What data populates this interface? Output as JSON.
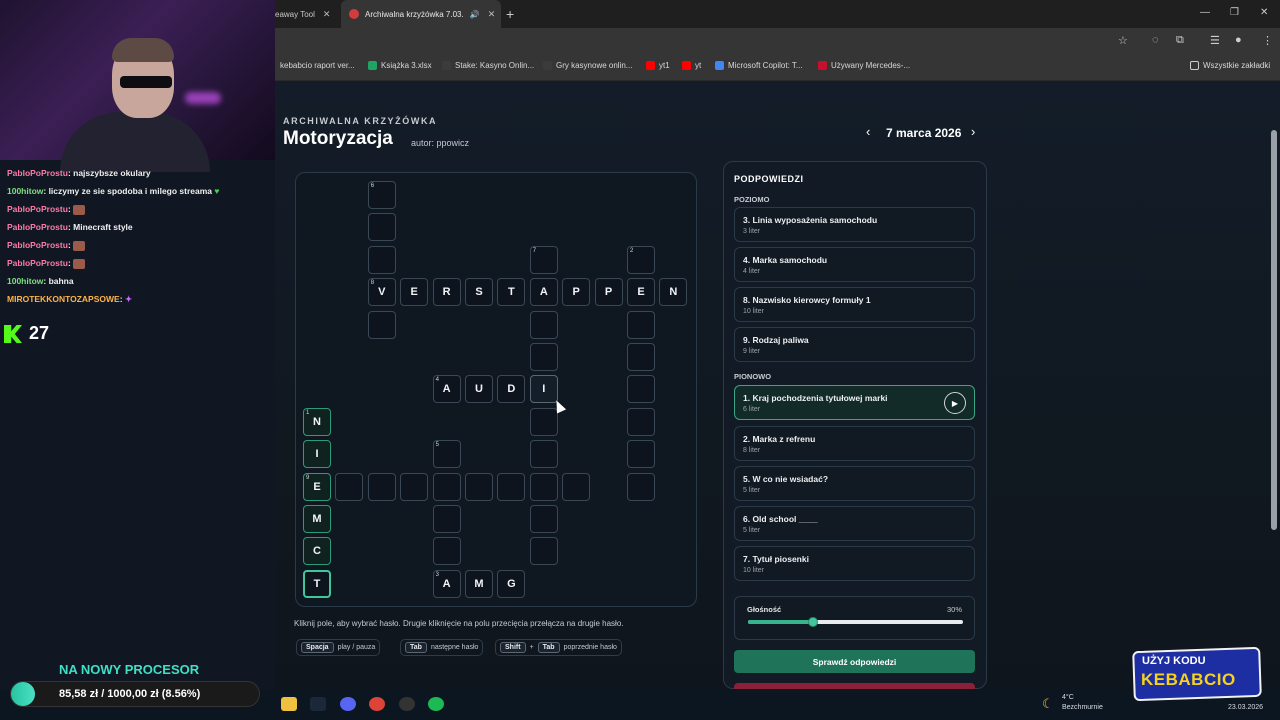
{
  "browser": {
    "tabs": [
      {
        "label": "eaway Tool"
      },
      {
        "label": "Archiwalna krzyżówka 7.03."
      }
    ],
    "bookmarks": [
      "kebabcio raport ver...",
      "Książka 3.xlsx",
      "Stake: Kasyno Onlin...",
      "Gry kasynowe onlin...",
      "yt1",
      "yt",
      "Microsoft Copilot: T...",
      "Używany Mercedes-...",
      "Wszystkie zakładki"
    ],
    "accent": "#41c69c"
  },
  "crossword": {
    "eyebrow": "ARCHIWALNA KRZYŻÓWKA",
    "title": "Motoryzacja",
    "author": "autor: ppowicz",
    "date": "7 marca 2026",
    "prev_icon": "chevron-left-icon",
    "next_icon": "chevron-right-icon",
    "hint": "Kliknij pole, aby wybrać hasło. Drugie kliknięcie na polu przecięcia przełącza na drugie hasło.",
    "shortcuts": [
      {
        "keys": [
          "Spacja"
        ],
        "label": "play / pauza"
      },
      {
        "keys": [
          "Tab"
        ],
        "label": "następne hasło"
      },
      {
        "keys": [
          "Shift",
          "Tab"
        ],
        "label": "poprzednie hasło"
      }
    ],
    "shortcut_plus": "+",
    "cells": [
      {
        "r": 0,
        "c": 2,
        "n": "6",
        "l": ""
      },
      {
        "r": 1,
        "c": 2,
        "n": "",
        "l": ""
      },
      {
        "r": 2,
        "c": 2,
        "n": "",
        "l": ""
      },
      {
        "r": 2,
        "c": 7,
        "n": "7",
        "l": ""
      },
      {
        "r": 2,
        "c": 10,
        "n": "2",
        "l": ""
      },
      {
        "r": 3,
        "c": 2,
        "n": "8",
        "l": "V"
      },
      {
        "r": 3,
        "c": 3,
        "n": "",
        "l": "E"
      },
      {
        "r": 3,
        "c": 4,
        "n": "",
        "l": "R"
      },
      {
        "r": 3,
        "c": 5,
        "n": "",
        "l": "S"
      },
      {
        "r": 3,
        "c": 6,
        "n": "",
        "l": "T"
      },
      {
        "r": 3,
        "c": 7,
        "n": "",
        "l": "A"
      },
      {
        "r": 3,
        "c": 8,
        "n": "",
        "l": "P"
      },
      {
        "r": 3,
        "c": 9,
        "n": "",
        "l": "P"
      },
      {
        "r": 3,
        "c": 10,
        "n": "",
        "l": "E"
      },
      {
        "r": 3,
        "c": 11,
        "n": "",
        "l": "N"
      },
      {
        "r": 4,
        "c": 2,
        "n": "",
        "l": ""
      },
      {
        "r": 4,
        "c": 7,
        "n": "",
        "l": ""
      },
      {
        "r": 4,
        "c": 10,
        "n": "",
        "l": ""
      },
      {
        "r": 5,
        "c": 7,
        "n": "",
        "l": ""
      },
      {
        "r": 5,
        "c": 10,
        "n": "",
        "l": ""
      },
      {
        "r": 6,
        "c": 4,
        "n": "4",
        "l": "A"
      },
      {
        "r": 6,
        "c": 5,
        "n": "",
        "l": "U"
      },
      {
        "r": 6,
        "c": 6,
        "n": "",
        "l": "D"
      },
      {
        "r": 6,
        "c": 7,
        "n": "",
        "l": "I",
        "s": "hl"
      },
      {
        "r": 6,
        "c": 10,
        "n": "",
        "l": ""
      },
      {
        "r": 7,
        "c": 0,
        "n": "1",
        "l": "N",
        "s": "sel"
      },
      {
        "r": 7,
        "c": 7,
        "n": "",
        "l": ""
      },
      {
        "r": 7,
        "c": 10,
        "n": "",
        "l": ""
      },
      {
        "r": 8,
        "c": 0,
        "n": "",
        "l": "I",
        "s": "sel"
      },
      {
        "r": 8,
        "c": 4,
        "n": "5",
        "l": ""
      },
      {
        "r": 8,
        "c": 7,
        "n": "",
        "l": ""
      },
      {
        "r": 8,
        "c": 10,
        "n": "",
        "l": ""
      },
      {
        "r": 9,
        "c": 0,
        "n": "9",
        "l": "E",
        "s": "sel"
      },
      {
        "r": 9,
        "c": 1,
        "n": "",
        "l": ""
      },
      {
        "r": 9,
        "c": 2,
        "n": "",
        "l": ""
      },
      {
        "r": 9,
        "c": 3,
        "n": "",
        "l": ""
      },
      {
        "r": 9,
        "c": 4,
        "n": "",
        "l": ""
      },
      {
        "r": 9,
        "c": 5,
        "n": "",
        "l": ""
      },
      {
        "r": 9,
        "c": 6,
        "n": "",
        "l": ""
      },
      {
        "r": 9,
        "c": 7,
        "n": "",
        "l": ""
      },
      {
        "r": 9,
        "c": 8,
        "n": "",
        "l": ""
      },
      {
        "r": 9,
        "c": 10,
        "n": "",
        "l": ""
      },
      {
        "r": 10,
        "c": 0,
        "n": "",
        "l": "M",
        "s": "sel"
      },
      {
        "r": 10,
        "c": 4,
        "n": "",
        "l": ""
      },
      {
        "r": 10,
        "c": 7,
        "n": "",
        "l": ""
      },
      {
        "r": 11,
        "c": 0,
        "n": "",
        "l": "C",
        "s": "sel"
      },
      {
        "r": 11,
        "c": 4,
        "n": "",
        "l": ""
      },
      {
        "r": 11,
        "c": 7,
        "n": "",
        "l": ""
      },
      {
        "r": 12,
        "c": 0,
        "n": "",
        "l": "T",
        "s": "cur"
      },
      {
        "r": 12,
        "c": 4,
        "n": "3",
        "l": "A"
      },
      {
        "r": 12,
        "c": 5,
        "n": "",
        "l": "M"
      },
      {
        "r": 12,
        "c": 6,
        "n": "",
        "l": "G"
      }
    ]
  },
  "clues": {
    "title": "PODPOWIEDZI",
    "across_label": "POZIOMO",
    "down_label": "PIONOWO",
    "across": [
      {
        "text": "3. Linia wyposażenia samochodu",
        "len": "3 liter"
      },
      {
        "text": "4. Marka samochodu",
        "len": "4 liter"
      },
      {
        "text": "8. Nazwisko kierowcy formuły 1",
        "len": "10 liter"
      },
      {
        "text": "9. Rodzaj paliwa",
        "len": "9 liter"
      }
    ],
    "down": [
      {
        "text": "1. Kraj pochodzenia tytułowej marki",
        "len": "6 liter",
        "active": true
      },
      {
        "text": "2. Marka z refrenu",
        "len": "8 liter"
      },
      {
        "text": "5. W co nie wsiadać?",
        "len": "5 liter"
      },
      {
        "text": "6. Old school ____",
        "len": "5 liter"
      },
      {
        "text": "7. Tytuł piosenki",
        "len": "10 liter"
      }
    ],
    "volume_label": "Głośność",
    "volume_pct": "30%",
    "volume_value": 0.3,
    "check_label": "Sprawdź odpowiedzi"
  },
  "stream": {
    "chat": [
      {
        "nick": "PabloPoProstu",
        "color": "pink",
        "msg": ": najszybsze okulary"
      },
      {
        "nick": "100hitow",
        "color": "green",
        "msg": ": liczymy ze sie spodoba i milego streama"
      },
      {
        "nick": "PabloPoProstu",
        "color": "pink",
        "msg": ":",
        "emote": true
      },
      {
        "nick": "PabloPoProstu",
        "color": "pink",
        "msg": ": Minecraft style"
      },
      {
        "nick": "PabloPoProstu",
        "color": "pink",
        "msg": ":",
        "emote": true
      },
      {
        "nick": "PabloPoProstu",
        "color": "pink",
        "msg": ":",
        "emote": true
      },
      {
        "nick": "100hitow",
        "color": "green",
        "msg": ": bahna"
      },
      {
        "nick": "MIROTEKKONTOZAPSOWE",
        "color": "gold",
        "msg": ":"
      }
    ],
    "viewers": "27",
    "goal_title": "NA NOWY PROCESOR",
    "goal_text": "85,58 zł / 1000,00 zł (8.56%)",
    "goal_fraction": 0.0856,
    "promo_line1": "UŻYJ KODU",
    "promo_line2": "KEBABCIO"
  },
  "taskbar": {
    "weather": "4°C",
    "weather_desc": "Bezchmurnie",
    "date": "23.03.2026"
  }
}
